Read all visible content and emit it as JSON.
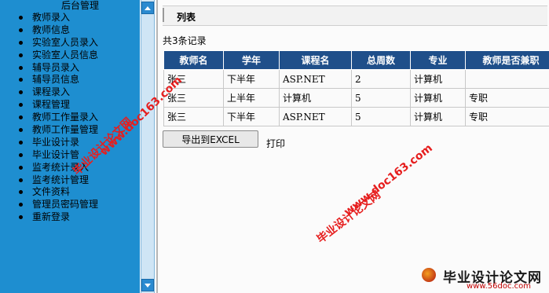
{
  "sidebar": {
    "title": "后台管理",
    "items": [
      {
        "label": "教师录入"
      },
      {
        "label": "教师信息"
      },
      {
        "label": "实验室人员录入"
      },
      {
        "label": "实验室人员信息"
      },
      {
        "label": "辅导员录入"
      },
      {
        "label": "辅导员信息"
      },
      {
        "label": "课程录入"
      },
      {
        "label": "课程管理"
      },
      {
        "label": "教师工作量录入"
      },
      {
        "label": "教师工作量管理"
      },
      {
        "label": "毕业设计录"
      },
      {
        "label": "毕业设计管"
      },
      {
        "label": "监考统计录入"
      },
      {
        "label": "监考统计管理"
      },
      {
        "label": "文件资料"
      },
      {
        "label": "管理员密码管理"
      },
      {
        "label": "重新登录"
      }
    ]
  },
  "main": {
    "section_title": "列表",
    "record_count": "共3条记录",
    "table": {
      "headers": [
        "教师名",
        "学年",
        "课程名",
        "总周数",
        "专业",
        "教师是否兼职"
      ],
      "rows": [
        [
          "张三",
          "下半年",
          "ASP.NET",
          "2",
          "计算机",
          ""
        ],
        [
          "张三",
          "上半年",
          "计算机",
          "5",
          "计算机",
          "专职"
        ],
        [
          "张三",
          "下半年",
          "ASP.NET",
          "5",
          "计算机",
          "专职"
        ]
      ]
    },
    "export_button": "导出到EXCEL",
    "print_link": "打印"
  },
  "watermarks": {
    "cn": "毕业设计论文网",
    "url": "www.doc163.com",
    "brand": "毕业设计论文网",
    "brand_url": "www.56doc.com"
  }
}
